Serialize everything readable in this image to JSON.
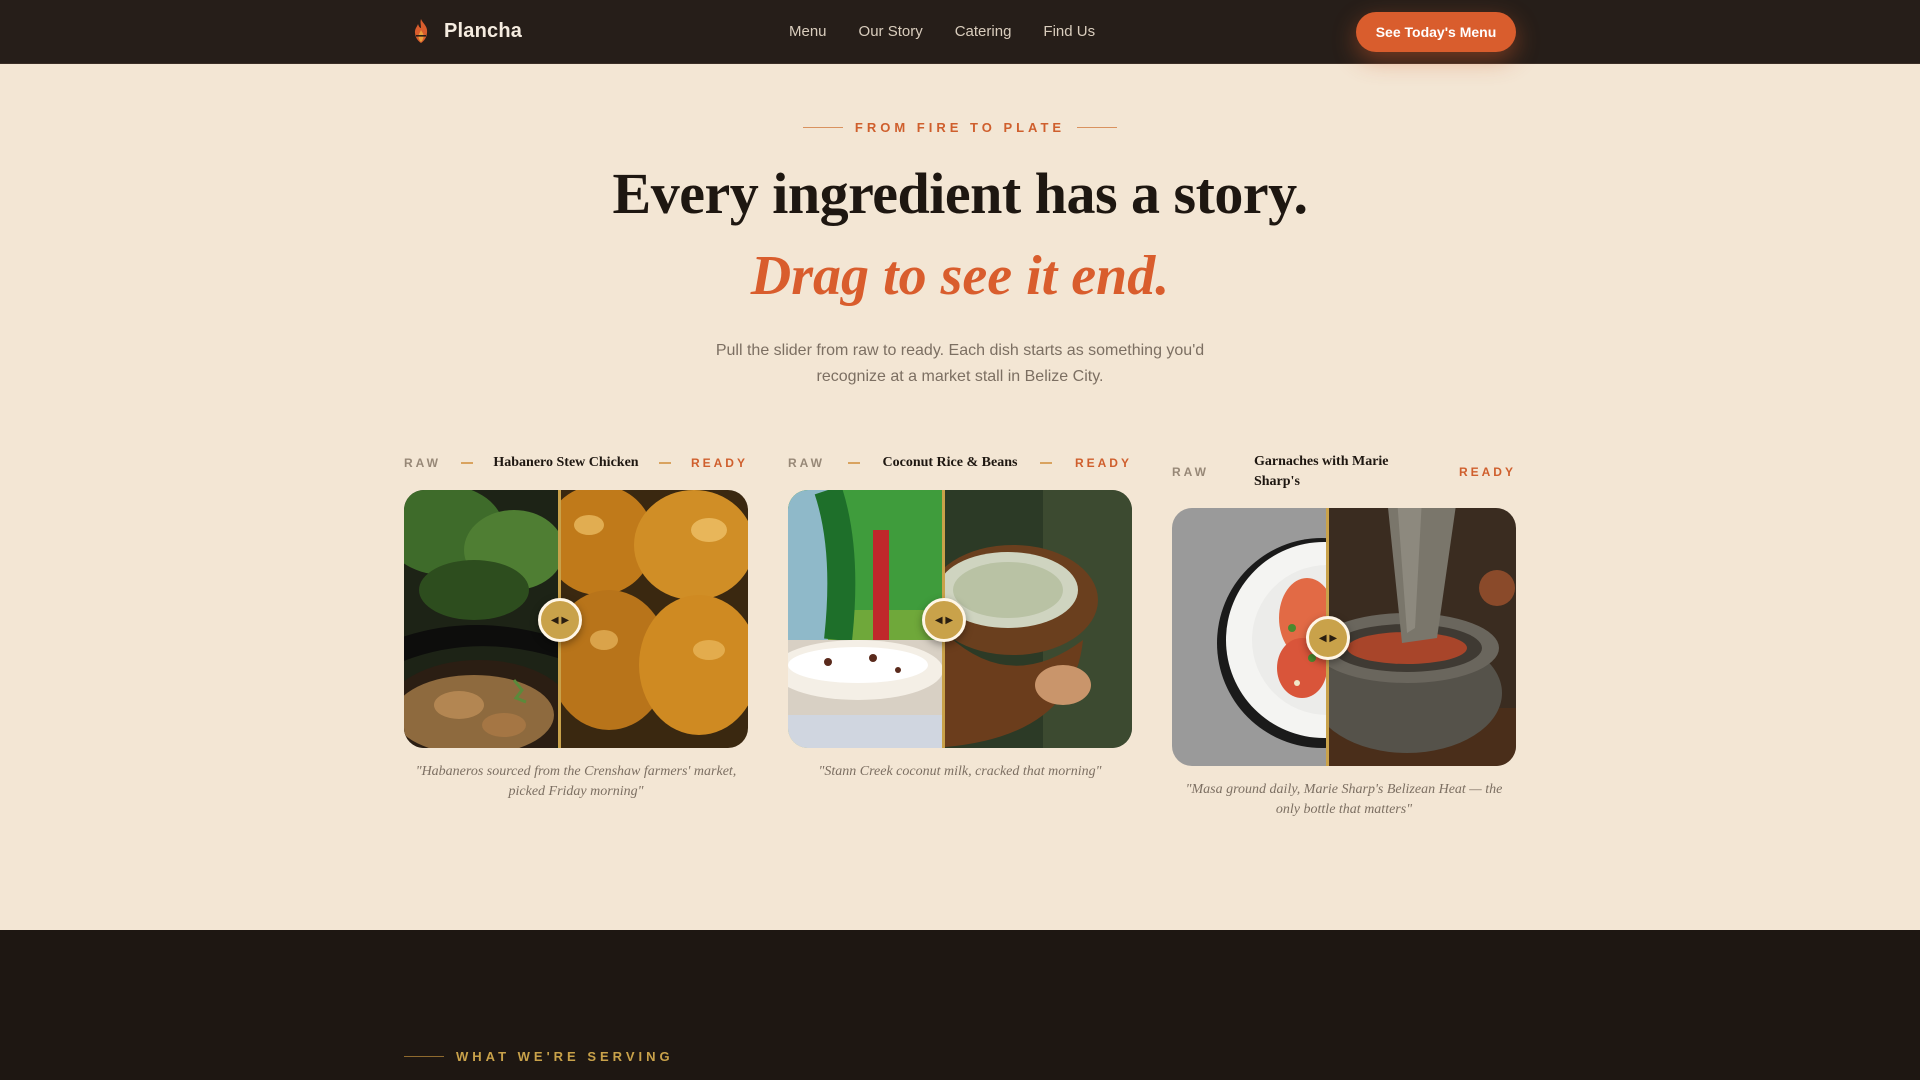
{
  "nav": {
    "brand": "Plancha",
    "links": [
      "Menu",
      "Our Story",
      "Catering",
      "Find Us"
    ],
    "cta": "See Today's Menu"
  },
  "hero": {
    "eyebrow": "FROM FIRE TO PLATE",
    "title": "Every ingredient has a story.",
    "subtitle": "Drag to see it end.",
    "description": "Pull the slider from raw to ready. Each dish starts as something you'd recognize at a market stall in Belize City."
  },
  "cards": [
    {
      "raw_label": "RAW",
      "ready_label": "READY",
      "name": "Habanero Stew Chicken",
      "caption": "\"Habaneros sourced from the Crenshaw farmers' market, picked Friday morning\"",
      "slider_position": 0.45
    },
    {
      "raw_label": "RAW",
      "ready_label": "READY",
      "name": "Coconut Rice & Beans",
      "caption": "\"Stann Creek coconut milk, cracked that morning\"",
      "slider_position": 0.45
    },
    {
      "raw_label": "RAW",
      "ready_label": "READY",
      "name": "Garnaches with Marie Sharp's",
      "caption": "\"Masa ground daily, Marie Sharp's Belizean Heat — the only bottle that matters\"",
      "slider_position": 0.45
    }
  ],
  "handle_glyph": "◀ ▶",
  "section": {
    "eyebrow": "WHAT WE'RE SERVING"
  },
  "colors": {
    "nav_bg": "#261e19",
    "page_bg": "#f3e6d4",
    "accent": "#d95d2d",
    "gold": "#c9a24a",
    "dark_section": "#1e1712"
  },
  "icons": {
    "brand": "flame-icon",
    "slider_handle": "drag-arrows-icon"
  }
}
